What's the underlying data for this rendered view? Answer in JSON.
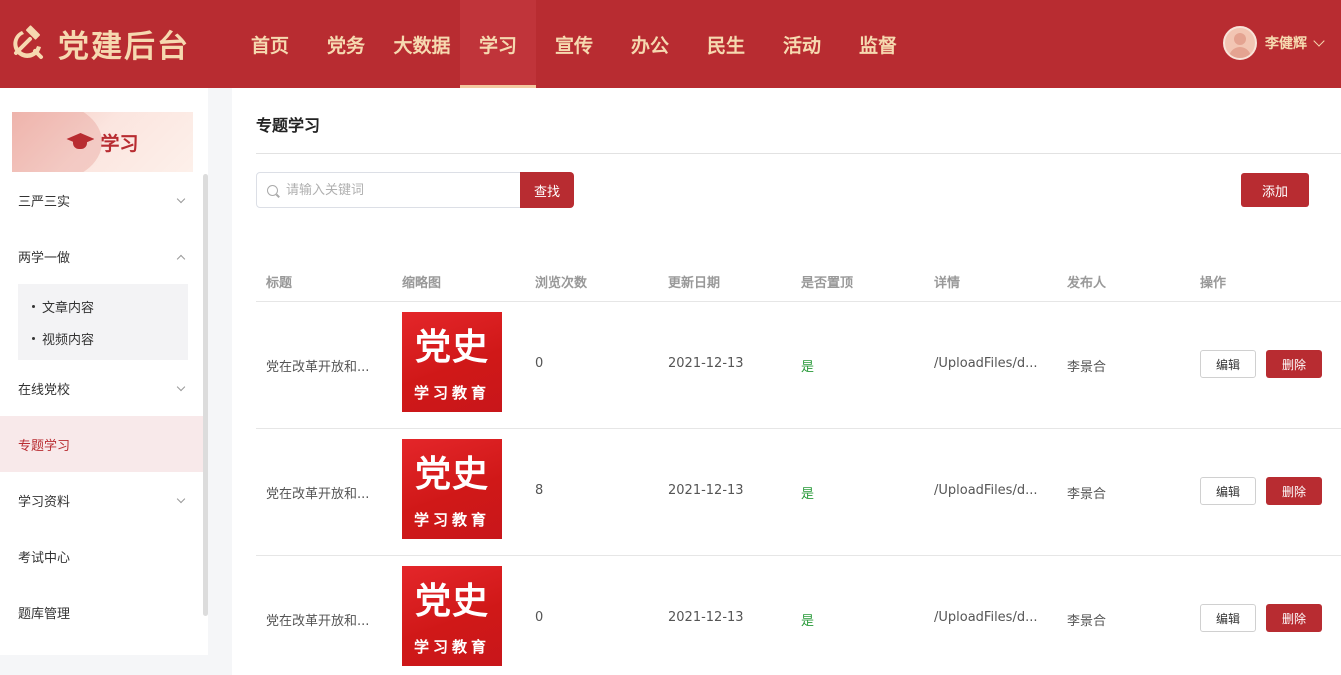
{
  "brand": {
    "title": "党建后台",
    "icon": "hammer-sickle-icon",
    "color": "#b82c31",
    "accent": "#f6d9b0"
  },
  "nav": {
    "items": [
      {
        "label": "首页"
      },
      {
        "label": "党务"
      },
      {
        "label": "大数据"
      },
      {
        "label": "学习",
        "active": true
      },
      {
        "label": "宣传"
      },
      {
        "label": "办公"
      },
      {
        "label": "民生"
      },
      {
        "label": "活动"
      },
      {
        "label": "监督"
      }
    ]
  },
  "user": {
    "name": "李健辉",
    "icon": "chevron-down-icon"
  },
  "sidebar": {
    "banner": {
      "label": "学习",
      "icon": "graduation-cap-icon"
    },
    "items": [
      {
        "label": "三严三实"
      },
      {
        "label": "两学一做"
      },
      {
        "label": "在线党校"
      },
      {
        "label": "专题学习",
        "active": true
      },
      {
        "label": "学习资料"
      },
      {
        "label": "考试中心"
      },
      {
        "label": "题库管理"
      }
    ],
    "subitems": [
      {
        "label": "文章内容"
      },
      {
        "label": "视频内容"
      }
    ]
  },
  "main": {
    "title": "专题学习",
    "search": {
      "placeholder": "请输入关键词",
      "value": ""
    },
    "search_button": "查找",
    "add_button": "添加",
    "table": {
      "headers": [
        "标题",
        "缩略图",
        "浏览次数",
        "更新日期",
        "是否置顶",
        "详情",
        "发布人",
        "操作"
      ],
      "thumbnail": {
        "top": "党史",
        "bottom": "学习教育"
      },
      "rows": [
        {
          "title": "党在改革开放和...",
          "views": "0",
          "date": "2021-12-13",
          "pinned": "是",
          "detail": "/UploadFiles/d...",
          "publisher": "李景合",
          "edit": "编辑",
          "delete": "删除"
        },
        {
          "title": "党在改革开放和...",
          "views": "8",
          "date": "2021-12-13",
          "pinned": "是",
          "detail": "/UploadFiles/d...",
          "publisher": "李景合",
          "edit": "编辑",
          "delete": "删除"
        },
        {
          "title": "党在改革开放和...",
          "views": "0",
          "date": "2021-12-13",
          "pinned": "是",
          "detail": "/UploadFiles/d...",
          "publisher": "李景合",
          "edit": "编辑",
          "delete": "删除"
        }
      ]
    }
  }
}
